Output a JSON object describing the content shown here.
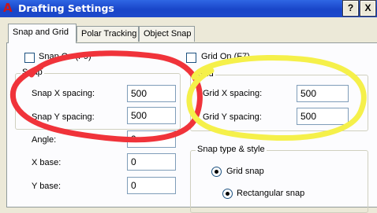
{
  "window": {
    "title": "Drafting Settings",
    "help_label": "?",
    "close_label": "X"
  },
  "tabs": [
    {
      "label": "Snap and Grid",
      "active": true
    },
    {
      "label": "Polar Tracking",
      "active": false
    },
    {
      "label": "Object Snap",
      "active": false
    }
  ],
  "snap_on": {
    "label": "Snap On (F9)",
    "checked": false
  },
  "grid_on": {
    "label": "Grid On (F7)",
    "checked": false
  },
  "snap_group": {
    "legend": "Snap",
    "x_spacing": {
      "label": "Snap X spacing:",
      "value": "500"
    },
    "y_spacing": {
      "label": "Snap Y spacing:",
      "value": "500"
    }
  },
  "grid_group": {
    "legend": "Grid",
    "x_spacing": {
      "label": "Grid X spacing:",
      "value": "500"
    },
    "y_spacing": {
      "label": "Grid Y spacing:",
      "value": "500"
    }
  },
  "angle": {
    "label": "Angle:",
    "value": "0"
  },
  "x_base": {
    "label": "X base:",
    "value": "0"
  },
  "y_base": {
    "label": "Y base:",
    "value": "0"
  },
  "snap_type_group": {
    "legend": "Snap type & style",
    "grid_snap": "Grid snap",
    "rectangular_snap": "Rectangular snap"
  },
  "annotations": {
    "red_color": "#f0333a",
    "yellow_color": "#f5f04a"
  }
}
